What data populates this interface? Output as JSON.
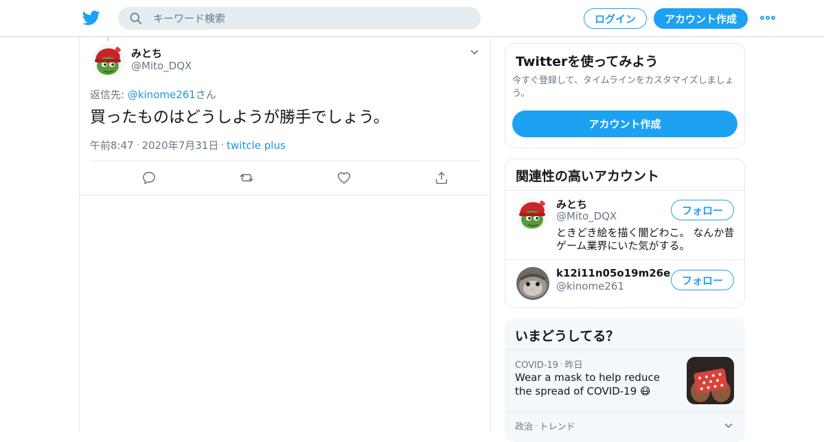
{
  "header": {
    "search_placeholder": "キーワード検索",
    "login_label": "ログイン",
    "signup_label": "アカウント作成"
  },
  "tweet": {
    "author_name": "みとち",
    "author_handle": "@Mito_DQX",
    "reply_prefix": "返信先: ",
    "reply_handle": "@kinome261",
    "reply_suffix": "さん",
    "text": "買ったものはどうしようが勝手でしょう。",
    "time": "午前8:47",
    "date": "2020年7月31日",
    "separator": "·",
    "source": "twitcle plus"
  },
  "signup_card": {
    "title": "Twitterを使ってみよう",
    "description": "今すぐ登録して、タイムラインをカスタマイズしましょう。",
    "button_label": "アカウント作成"
  },
  "related_card": {
    "title": "関連性の高いアカウント",
    "accounts": [
      {
        "name": "みとち",
        "handle": "@Mito_DQX",
        "bio": "ときどき絵を描く闇どわこ。 なんか昔ゲーム業界にいた気がする。",
        "follow_label": "フォロー"
      },
      {
        "name": "k12i11n05o19m26e",
        "handle": "@kinome261",
        "bio": "",
        "follow_label": "フォロー"
      }
    ]
  },
  "trends_card": {
    "title": "いまどうしてる？",
    "items": [
      {
        "category": "COVID-19",
        "separator": "·",
        "time": "昨日",
        "text": "Wear a mask to help reduce the spread of COVID-19 😷"
      },
      {
        "category": "政治",
        "separator": "·",
        "time": "トレンド"
      }
    ]
  },
  "colors": {
    "brand": "#1da1f2",
    "link": "#1b95e0",
    "secondary_text": "#657786",
    "border": "#e1e8ed"
  },
  "icons": [
    "twitter-bird-icon",
    "search-icon",
    "more-icon",
    "chevron-down-icon",
    "reply-icon",
    "retweet-icon",
    "like-icon",
    "share-icon"
  ]
}
